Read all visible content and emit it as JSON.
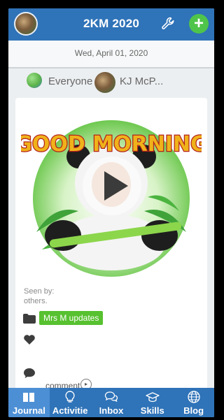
{
  "header": {
    "title": "2KM 2020",
    "icons": {
      "left": "avatar",
      "wrench": "wrench-icon",
      "add": "plus-icon"
    },
    "add_label": "+"
  },
  "date_bar": {
    "date": "Wed, April 01, 2020"
  },
  "audience": {
    "everyone_label": "Everyone",
    "person_label": "KJ McP..."
  },
  "post": {
    "media_title": "GOOD MORNING",
    "seen_by": "Seen by:",
    "seen_others": "others.",
    "folder_tag": "Mrs M updates",
    "comment_label": "comment.",
    "comment_play": "▸"
  },
  "nav": {
    "items": [
      {
        "label": "Journal",
        "icon": "journal-icon",
        "active": true
      },
      {
        "label": "Activitie",
        "icon": "lightbulb-icon",
        "active": false
      },
      {
        "label": "Inbox",
        "icon": "chat-bubbles-icon",
        "active": false
      },
      {
        "label": "Skills",
        "icon": "graduation-cap-icon",
        "active": false
      },
      {
        "label": "Blog",
        "icon": "globe-icon",
        "active": false
      }
    ]
  },
  "colors": {
    "brand_blue": "#2f73b8",
    "accent_green": "#57c12f",
    "add_green": "#4fc44a"
  }
}
